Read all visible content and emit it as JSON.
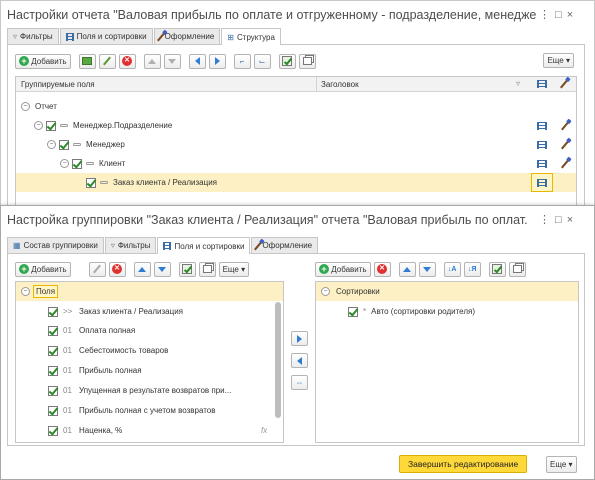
{
  "window1": {
    "title": "Настройки отчета \"Валовая прибыль по оплате и отгруженному - подразделение, менеджер\"",
    "controls": "⋮ □ ×",
    "tabs": [
      {
        "label": "Фильтры",
        "icon": "filter-icon"
      },
      {
        "label": "Поля и сортировки",
        "icon": "fields-icon"
      },
      {
        "label": "Оформление",
        "icon": "brush-icon"
      },
      {
        "label": "Структура",
        "icon": "structure-icon",
        "active": true
      }
    ],
    "toolbar": {
      "add_label": "Добавить",
      "more_label": "Еще"
    },
    "grid": {
      "col_fields": "Группируемые поля",
      "col_header": "Заголовок",
      "rows": [
        {
          "label": "Отчет",
          "level": 0,
          "check": false
        },
        {
          "label": "Менеджер.Подразделение",
          "level": 1,
          "check": true
        },
        {
          "label": "Менеджер",
          "level": 2,
          "check": true
        },
        {
          "label": "Клиент",
          "level": 3,
          "check": true
        },
        {
          "label": "Заказ клиента / Реализация",
          "level": 4,
          "check": true,
          "selected": true
        }
      ]
    }
  },
  "window2": {
    "title": "Настройка группировки \"Заказ клиента / Реализация\" отчета \"Валовая прибыль по оплат...",
    "controls": "⋮ □ ×",
    "tabs": [
      {
        "label": "Состав группировки",
        "icon": "table-icon"
      },
      {
        "label": "Фильтры",
        "icon": "filter-icon"
      },
      {
        "label": "Поля и сортировки",
        "icon": "fields-icon",
        "active": true
      },
      {
        "label": "Оформление",
        "icon": "brush-icon"
      }
    ],
    "left": {
      "add_label": "Добавить",
      "more_label": "Еще",
      "root": "Поля",
      "items": [
        {
          "prefix": ">>",
          "label": "Заказ клиента / Реализация"
        },
        {
          "prefix": "01",
          "label": "Оплата полная"
        },
        {
          "prefix": "01",
          "label": "Себестоимость товаров"
        },
        {
          "prefix": "01",
          "label": "Прибыль полная"
        },
        {
          "prefix": "01",
          "label": "Упущенная в результате возвратов при..."
        },
        {
          "prefix": "01",
          "label": "Прибыль полная с учетом возвратов"
        },
        {
          "prefix": "01",
          "label": "Наценка, %",
          "fx": "fx"
        }
      ]
    },
    "right": {
      "add_label": "Добавить",
      "root": "Сортировки",
      "items": [
        {
          "label": "Авто (сортировки родителя)",
          "prefix": "*"
        }
      ]
    },
    "footer": {
      "finish_label": "Завершить редактирование",
      "more_label": "Еще"
    }
  }
}
